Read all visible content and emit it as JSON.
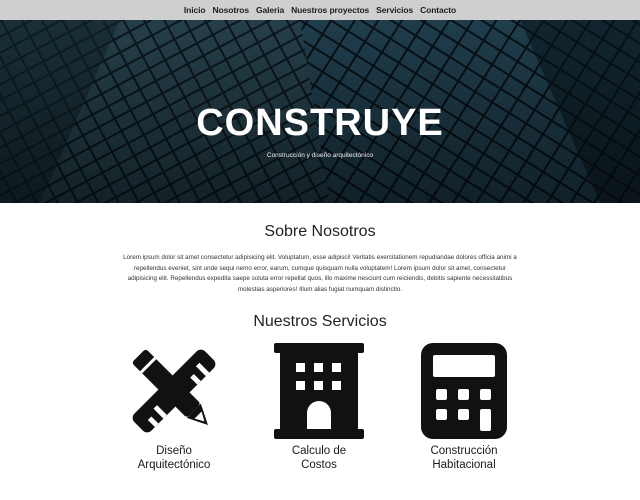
{
  "nav": {
    "items": [
      "Inicio",
      "Nosotros",
      "Galeria",
      "Nuestros proyectos",
      "Servicios",
      "Contacto"
    ]
  },
  "hero": {
    "title": "CONSTRUYE",
    "subtitle": "Construcción y diseño arquitectónico"
  },
  "about": {
    "heading": "Sobre Nosotros",
    "body": "Lorem ipsum dolor sit amet consectetur adipisicing elit. Voluptatum, esse adipisci! Veritatis exercitationem repudiandae dolores officia animi a repellendus eveniet, sint unde sequi nemo error, earum, cumque quisquam nulla voluptatem! Lorem ipsum dolor sit amet, consectetur adipisicing elit. Repellendus expedita saepe soluta error repellat quos, illo maxime nesciunt cum reiciendis, debitis sapiente necessitatibus molestias asperiores! Illum alias fugiat numquam distinctio."
  },
  "services": {
    "heading": "Nuestros Servicios",
    "items": [
      {
        "label": "Diseño\nArquitectónico",
        "icon": "pencil-ruler-icon"
      },
      {
        "label": "Calculo de\nCostos",
        "icon": "building-icon"
      },
      {
        "label": "Construcción\nHabitacional",
        "icon": "calculator-icon"
      }
    ]
  }
}
